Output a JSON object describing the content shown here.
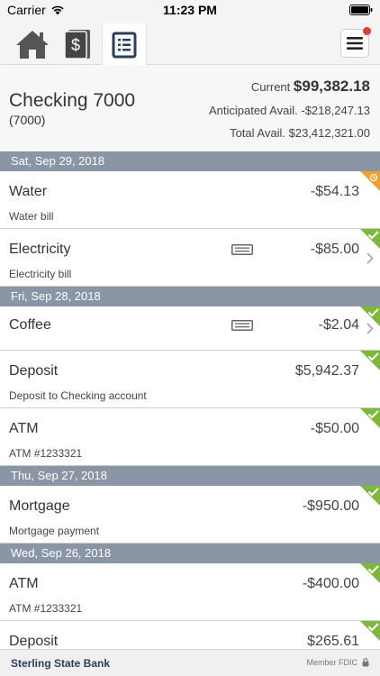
{
  "status": {
    "carrier": "Carrier",
    "time": "11:23 PM"
  },
  "nav": {
    "tabs": [
      "home-icon",
      "dollar-card-icon",
      "statement-icon"
    ],
    "active_tab": 2,
    "menu_icon": "hamburger-icon"
  },
  "account": {
    "name": "Checking 7000",
    "number": "(7000)",
    "current_label": "Current",
    "current_value": "$99,382.18",
    "anticipated_label": "Anticipated Avail.",
    "anticipated_value": "-$218,247.13",
    "total_label": "Total Avail.",
    "total_value": "$23,412,321.00"
  },
  "dates": [
    "Sat, Sep 29, 2018",
    "Fri, Sep 28, 2018",
    "Thu, Sep 27, 2018",
    "Wed, Sep 26, 2018"
  ],
  "transactions": [
    {
      "name": "Water",
      "desc": "Water bill",
      "amount": "-$54.13",
      "status": "pending"
    },
    {
      "name": "Electricity",
      "desc": "Electricity bill",
      "amount": "-$85.00",
      "status": "cleared"
    },
    {
      "name": "Coffee",
      "desc": "",
      "amount": "-$2.04",
      "status": "cleared"
    },
    {
      "name": "Deposit",
      "desc": "Deposit to Checking account",
      "amount": "$5,942.37",
      "status": "cleared"
    },
    {
      "name": "ATM",
      "desc": "ATM #1233321",
      "amount": "-$50.00",
      "status": "cleared"
    },
    {
      "name": "Mortgage",
      "desc": "Mortgage payment",
      "amount": "-$950.00",
      "status": "cleared"
    },
    {
      "name": "ATM",
      "desc": "ATM #1233321",
      "amount": "-$400.00",
      "status": "cleared"
    },
    {
      "name": "Deposit",
      "desc": "",
      "amount": "$265.61",
      "status": "cleared"
    }
  ],
  "footer": {
    "bank": "Sterling State Bank",
    "fdic": "Member FDIC"
  },
  "colors": {
    "date_header": "#8a95a6",
    "cleared": "#7cb93a",
    "pending": "#f0a030",
    "brand": "#2b3e5c"
  }
}
